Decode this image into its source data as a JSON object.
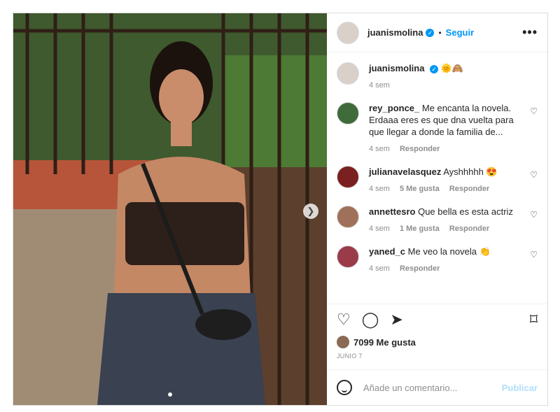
{
  "post": {
    "username": "juanismolina",
    "follow_label": "Seguir",
    "more_label": "•••",
    "separator": "•",
    "caption": {
      "username": "juanismolina",
      "emoji": "🌞🙈",
      "time": "4 sem"
    },
    "comments": [
      {
        "user": "rey_ponce_",
        "text": "Me encanta la novela. Erdaaa eres es que dna vuelta para que llegar a donde la familia de...",
        "time": "4 sem",
        "likes": "",
        "reply": "Responder",
        "avatar": "#3f6b3a"
      },
      {
        "user": "julianavelasquez",
        "text": "Ayshhhhh 😍",
        "time": "4 sem",
        "likes": "5 Me gusta",
        "reply": "Responder",
        "avatar": "#7a2020"
      },
      {
        "user": "annettesro",
        "text": "Que bella es esta actriz",
        "time": "4 sem",
        "likes": "1 Me gusta",
        "reply": "Responder",
        "avatar": "#a0715a"
      },
      {
        "user": "yaned_c",
        "text": "Me veo la novela 👏",
        "time": "4 sem",
        "likes": "",
        "reply": "Responder",
        "avatar": "#9a3b4a"
      }
    ],
    "likes_text": "7099 Me gusta",
    "date": "JUNIO 7",
    "comment_placeholder": "Añade un comentario...",
    "publish_label": "Publicar",
    "icons": {
      "like": "heart-icon",
      "comment": "comment-icon",
      "share": "send-icon",
      "save": "bookmark-icon",
      "next": "chevron-right-icon",
      "emoji": "emoji-icon"
    }
  }
}
